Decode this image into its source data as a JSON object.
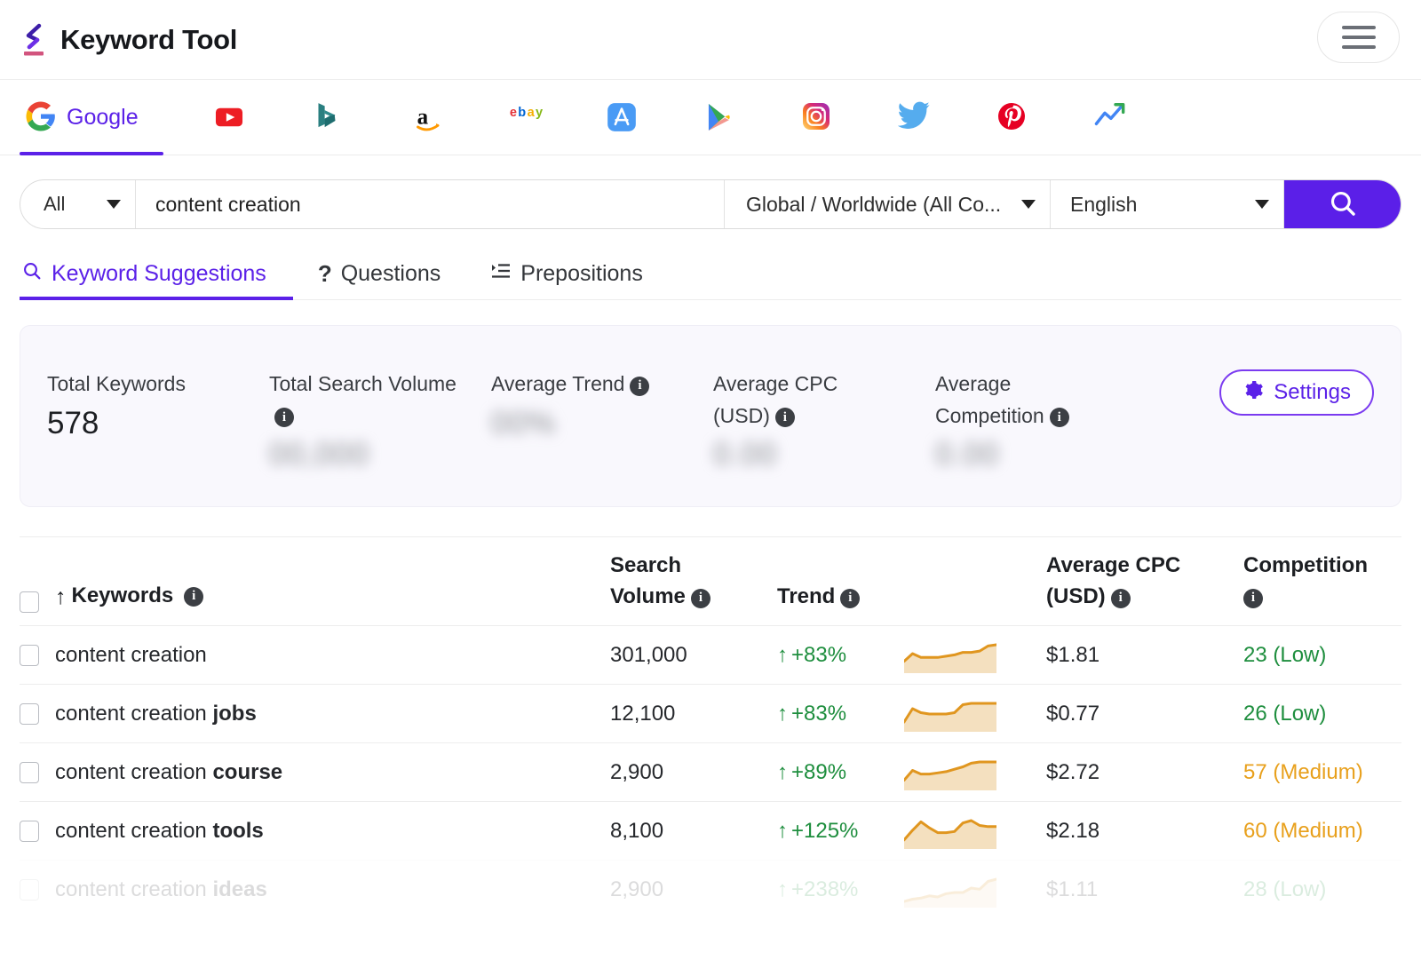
{
  "header": {
    "app_title": "Keyword Tool",
    "logo_icon": "keywordtool-logo-icon",
    "menu_icon": "hamburger-menu-icon"
  },
  "platform_tabs": [
    {
      "id": "google",
      "label": "Google",
      "icon": "google-icon",
      "active": true
    },
    {
      "id": "youtube",
      "label": "",
      "icon": "youtube-icon",
      "active": false
    },
    {
      "id": "bing",
      "label": "",
      "icon": "bing-icon",
      "active": false
    },
    {
      "id": "amazon",
      "label": "",
      "icon": "amazon-icon",
      "active": false
    },
    {
      "id": "ebay",
      "label": "",
      "icon": "ebay-icon",
      "active": false
    },
    {
      "id": "appstore",
      "label": "",
      "icon": "app-store-icon",
      "active": false
    },
    {
      "id": "playstore",
      "label": "",
      "icon": "google-play-icon",
      "active": false
    },
    {
      "id": "instagram",
      "label": "",
      "icon": "instagram-icon",
      "active": false
    },
    {
      "id": "twitter",
      "label": "",
      "icon": "twitter-icon",
      "active": false
    },
    {
      "id": "pinterest",
      "label": "",
      "icon": "pinterest-icon",
      "active": false
    },
    {
      "id": "trends",
      "label": "",
      "icon": "google-trends-icon",
      "active": false
    }
  ],
  "search": {
    "scope_value": "All",
    "keyword_value": "content creation",
    "keyword_placeholder": "content creation",
    "country_value": "Global / Worldwide (All Co...",
    "language_value": "English",
    "search_icon": "search-icon"
  },
  "sub_tabs": [
    {
      "id": "keyword-suggestions",
      "label": "Keyword Suggestions",
      "icon": "search-icon",
      "active": true
    },
    {
      "id": "questions",
      "label": "Questions",
      "icon": "question-mark-icon",
      "active": false
    },
    {
      "id": "prepositions",
      "label": "Prepositions",
      "icon": "list-icon",
      "active": false
    }
  ],
  "stats": {
    "items": [
      {
        "label": "Total Keywords",
        "value": "578",
        "blurred": false,
        "has_info": false
      },
      {
        "label": "Total Search Volume",
        "value": "00,000",
        "blurred": true,
        "has_info": true
      },
      {
        "label": "Average Trend",
        "value": "00%",
        "blurred": true,
        "has_info": true
      },
      {
        "label": "Average CPC (USD)",
        "value": "0.00",
        "blurred": true,
        "has_info": true
      },
      {
        "label": "Average Competition",
        "value": "0.00",
        "blurred": true,
        "has_info": true
      }
    ],
    "settings_label": "Settings",
    "settings_icon": "gear-icon"
  },
  "table": {
    "columns": {
      "keywords": "Keywords",
      "search_volume": "Search Volume",
      "trend": "Trend",
      "average_cpc": "Average CPC (USD)",
      "competition": "Competition",
      "sort_icon": "sort-ascending-arrow-icon"
    },
    "rows": [
      {
        "keyword_base": "content creation",
        "keyword_bold": "",
        "search_volume": "301,000",
        "trend": "+83%",
        "cpc": "$1.81",
        "competition": "23 (Low)",
        "competition_level": "low",
        "faded": false,
        "spark": [
          8,
          14,
          11,
          11,
          11,
          12,
          13,
          15,
          15,
          16,
          20,
          21
        ]
      },
      {
        "keyword_base": "content creation ",
        "keyword_bold": "jobs",
        "search_volume": "12,100",
        "trend": "+83%",
        "cpc": "$0.77",
        "competition": "26 (Low)",
        "competition_level": "low",
        "faded": false,
        "spark": [
          6,
          16,
          13,
          12,
          12,
          12,
          13,
          19,
          20,
          20,
          20,
          20
        ]
      },
      {
        "keyword_base": "content creation ",
        "keyword_bold": "course",
        "search_volume": "2,900",
        "trend": "+89%",
        "cpc": "$2.72",
        "competition": "57 (Medium)",
        "competition_level": "medium",
        "faded": false,
        "spark": [
          7,
          15,
          12,
          12,
          13,
          14,
          16,
          18,
          21,
          22,
          22,
          22
        ]
      },
      {
        "keyword_base": "content creation ",
        "keyword_bold": "tools",
        "search_volume": "8,100",
        "trend": "+125%",
        "cpc": "$2.18",
        "competition": "60 (Medium)",
        "competition_level": "medium",
        "faded": false,
        "spark": [
          6,
          14,
          21,
          16,
          12,
          12,
          13,
          20,
          22,
          18,
          17,
          17
        ]
      },
      {
        "keyword_base": "content creation ",
        "keyword_bold": "ideas",
        "search_volume": "2,900",
        "trend": "+238%",
        "cpc": "$1.11",
        "competition": "28 (Low)",
        "competition_level": "low",
        "faded": true,
        "spark": [
          4,
          6,
          7,
          9,
          8,
          11,
          12,
          12,
          16,
          15,
          22,
          24
        ]
      }
    ]
  },
  "colors": {
    "accent_purple": "#5b1fe8",
    "green": "#1e8e3e",
    "orange": "#e8a01c",
    "spark_line": "#e0961f",
    "spark_fill": "#f4e0bf",
    "panel_bg": "#f9f8fd"
  },
  "chart_data": {
    "type": "table",
    "title": "Keyword Suggestions for \"content creation\"",
    "columns": [
      "Keywords",
      "Search Volume",
      "Trend",
      "Average CPC (USD)",
      "Competition"
    ],
    "rows": [
      [
        "content creation",
        301000,
        "+83%",
        1.81,
        "23 (Low)"
      ],
      [
        "content creation jobs",
        12100,
        "+83%",
        0.77,
        "26 (Low)"
      ],
      [
        "content creation course",
        2900,
        "+89%",
        2.72,
        "57 (Medium)"
      ],
      [
        "content creation tools",
        8100,
        "+125%",
        2.18,
        "60 (Medium)"
      ],
      [
        "content creation ideas",
        2900,
        "+238%",
        1.11,
        "28 (Low)"
      ]
    ],
    "sparkline_series": [
      {
        "name": "content creation",
        "values": [
          8,
          14,
          11,
          11,
          11,
          12,
          13,
          15,
          15,
          16,
          20,
          21
        ]
      },
      {
        "name": "content creation jobs",
        "values": [
          6,
          16,
          13,
          12,
          12,
          12,
          13,
          19,
          20,
          20,
          20,
          20
        ]
      },
      {
        "name": "content creation course",
        "values": [
          7,
          15,
          12,
          12,
          13,
          14,
          16,
          18,
          21,
          22,
          22,
          22
        ]
      },
      {
        "name": "content creation tools",
        "values": [
          6,
          14,
          21,
          16,
          12,
          12,
          13,
          20,
          22,
          18,
          17,
          17
        ]
      },
      {
        "name": "content creation ideas",
        "values": [
          4,
          6,
          7,
          9,
          8,
          11,
          12,
          12,
          16,
          15,
          22,
          24
        ]
      }
    ],
    "summary": {
      "total_keywords": 578
    }
  }
}
